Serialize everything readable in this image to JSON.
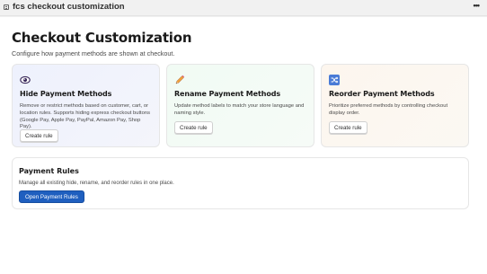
{
  "app": {
    "title": "fcs checkout customization",
    "more_icon": "more-horizontal-icon"
  },
  "page": {
    "title": "Checkout Customization",
    "subtitle": "Configure how payment methods are shown at checkout."
  },
  "cards": [
    {
      "icon": "eye-icon",
      "title": "Hide Payment Methods",
      "description": "Remove or restrict methods based on customer, cart, or location rules. Supports hiding express checkout buttons (Google Pay, Apple Pay, PayPal, Amazon Pay, Shop Pay).",
      "button_label": "Create rule"
    },
    {
      "icon": "pencil-icon",
      "title": "Rename Payment Methods",
      "description": "Update method labels to match your store language and naming style.",
      "button_label": "Create rule"
    },
    {
      "icon": "shuffle-icon",
      "title": "Reorder Payment Methods",
      "description": "Prioritize preferred methods by controlling checkout display order.",
      "button_label": "Create rule"
    }
  ],
  "rules": {
    "title": "Payment Rules",
    "description": "Manage all existing hide, rename, and reorder rules in one place.",
    "button_label": "Open Payment Rules"
  },
  "colors": {
    "primary_button": "#1f5fbf",
    "reorder_icon": "#4a7bd6"
  }
}
